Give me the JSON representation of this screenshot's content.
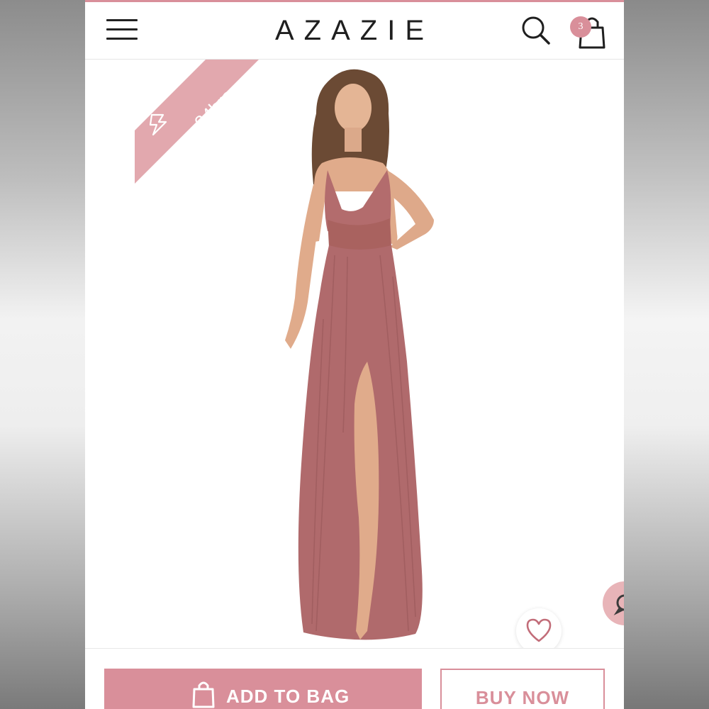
{
  "app": {
    "brand": "AZAZIE",
    "accent_color": "#d98f9a",
    "dress_color": "#b06a6c"
  },
  "header": {
    "menu_icon": "hamburger-menu-icon",
    "search_icon": "search-icon",
    "bag_icon": "shopping-bag-icon",
    "bag_count": "3"
  },
  "product": {
    "badge_text": "24hrs",
    "badge_icon": "lightning-icon",
    "image_description_icon": "model-photo",
    "wishlist_icon": "heart-icon",
    "chat_icon": "chat-bubble-icon"
  },
  "actions": {
    "add_to_bag": "ADD TO BAG",
    "buy_now": "BUY NOW"
  }
}
